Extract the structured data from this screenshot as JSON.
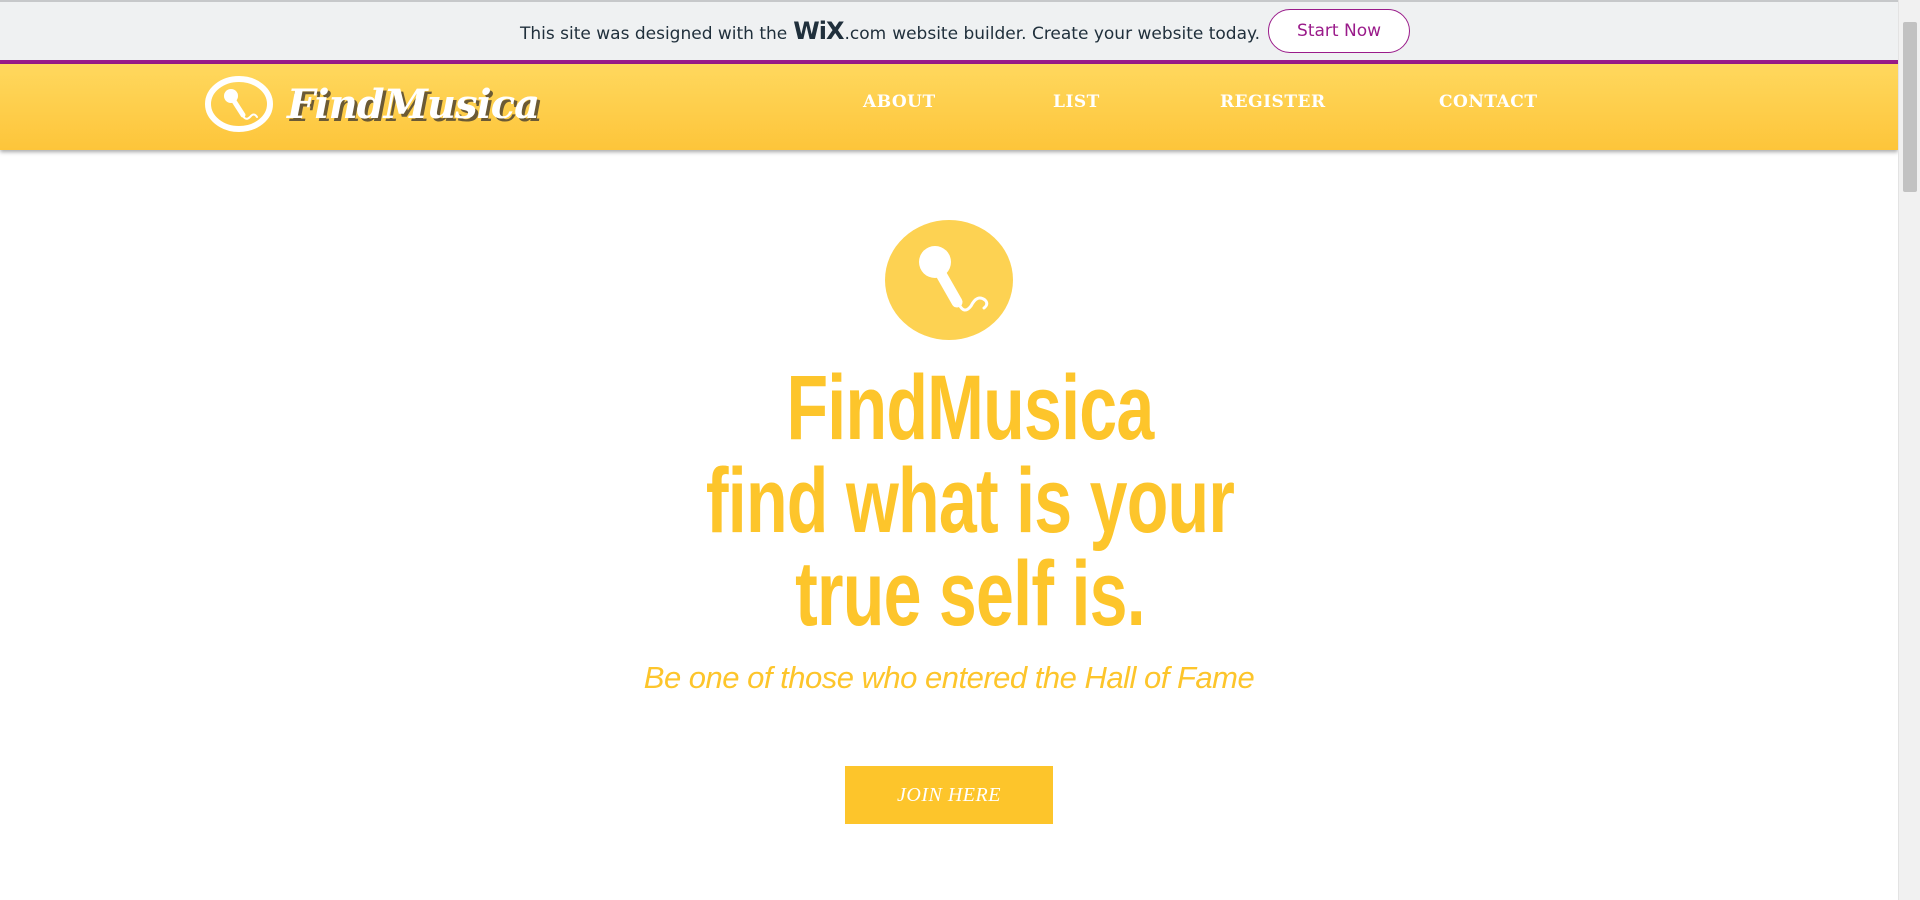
{
  "wix_banner": {
    "text_before": "This site was designed with the",
    "wix_logo": "WiX",
    "dotcom": ".com",
    "text_after": "website builder. Create your website today.",
    "cta_label": "Start Now",
    "accent_color": "#9a1b8a"
  },
  "header": {
    "logo_text": "FindMusica",
    "logo_icon": "microphone-icon",
    "nav": [
      {
        "label": "ABOUT"
      },
      {
        "label": "LIST"
      },
      {
        "label": "REGISTER"
      },
      {
        "label": "CONTACT"
      }
    ],
    "background_color": "#fdc93f"
  },
  "hero": {
    "icon": "microphone-icon",
    "title_lines": [
      "FindMusica",
      "find what is your",
      "true self is."
    ],
    "subtitle": "Be one of those who entered the Hall of Fame",
    "cta_label": "JOIN HERE",
    "accent_color": "#fdc52b"
  }
}
